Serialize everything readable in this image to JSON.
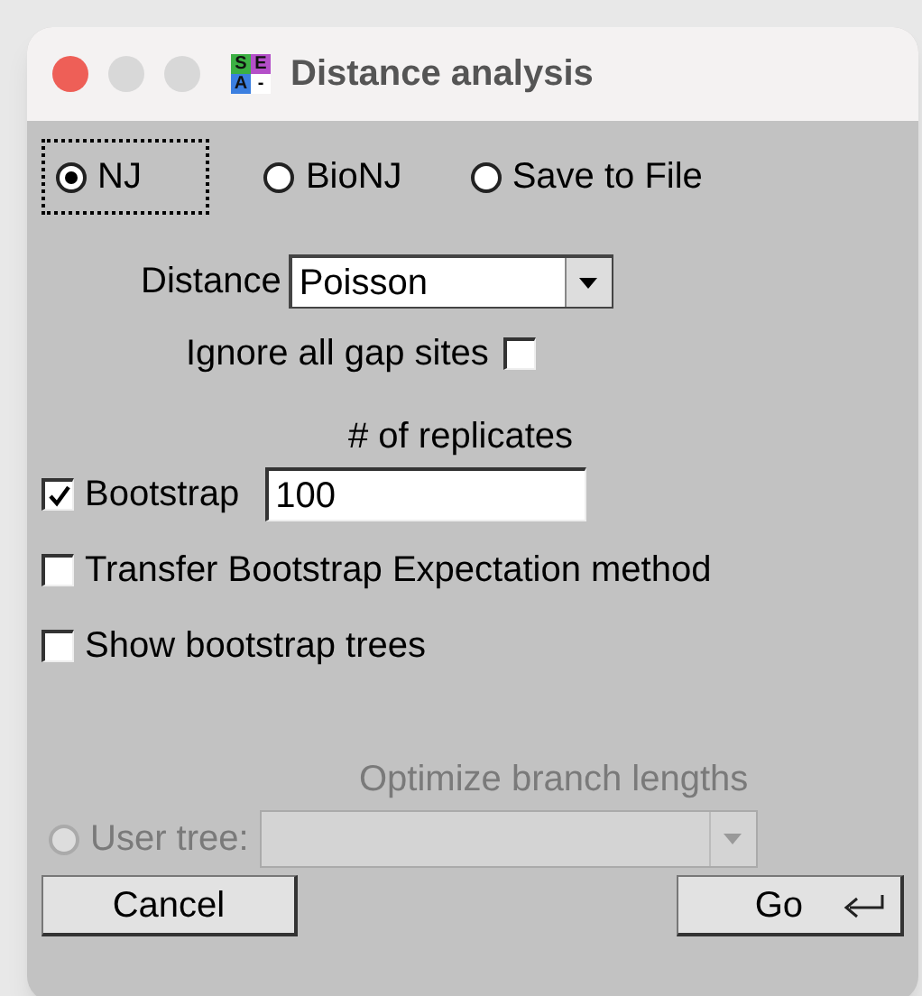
{
  "window": {
    "title": "Distance analysis",
    "app_icon": [
      "S",
      "E",
      "A",
      "-"
    ]
  },
  "methods": [
    {
      "label": "NJ",
      "selected": true,
      "focused": true
    },
    {
      "label": "BioNJ",
      "selected": false,
      "focused": false
    },
    {
      "label": "Save to File",
      "selected": false,
      "focused": false
    }
  ],
  "distance": {
    "label": "Distance",
    "value": "Poisson"
  },
  "ignore_gaps": {
    "label": "Ignore all gap sites",
    "checked": false
  },
  "replicates": {
    "label": "# of replicates",
    "value": "100"
  },
  "options": [
    {
      "label": "Bootstrap",
      "checked": true,
      "kind": "replicates"
    },
    {
      "label": "Transfer Bootstrap Expectation method",
      "checked": false,
      "kind": "plain"
    },
    {
      "label": "Show bootstrap trees",
      "checked": false,
      "kind": "plain"
    }
  ],
  "optimize": {
    "label": "Optimize branch lengths",
    "disabled": true
  },
  "user_tree": {
    "label": "User tree:",
    "selected": false,
    "disabled": true
  },
  "buttons": [
    {
      "label": "Cancel",
      "kind": "cancel"
    },
    {
      "label": "Go",
      "kind": "default"
    }
  ]
}
